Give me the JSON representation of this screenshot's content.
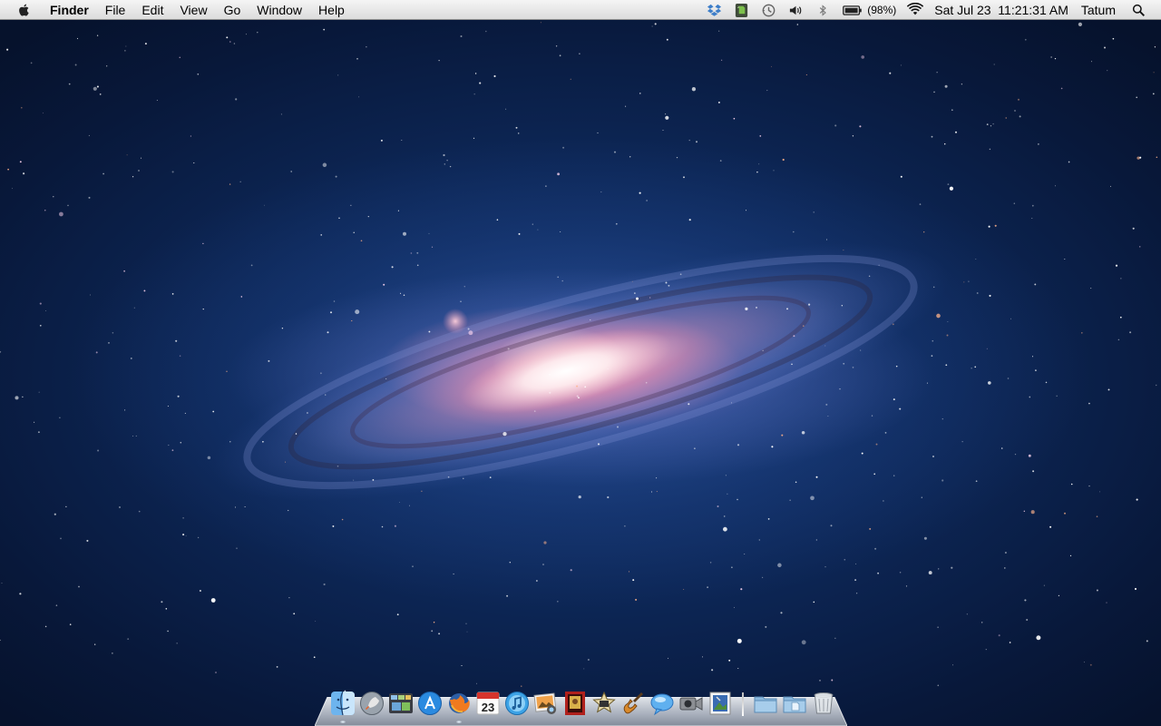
{
  "menubar": {
    "app_name": "Finder",
    "menus": [
      "File",
      "Edit",
      "View",
      "Go",
      "Window",
      "Help"
    ],
    "status_icons": [
      "dropbox-icon",
      "evernote-icon",
      "time-machine-icon",
      "volume-icon",
      "bluetooth-icon",
      "battery-icon",
      "wifi-icon",
      "spotlight-icon"
    ],
    "battery_percent": "(98%)",
    "datetime": "Sat Jul 23  11:21:31 AM",
    "user": "Tatum"
  },
  "desktop": {
    "wallpaper": "andromeda-galaxy"
  },
  "dock": {
    "items": [
      {
        "name": "finder-icon",
        "running": true
      },
      {
        "name": "launchpad-icon",
        "running": false
      },
      {
        "name": "mission-control-icon",
        "running": false
      },
      {
        "name": "app-store-icon",
        "running": false
      },
      {
        "name": "firefox-icon",
        "running": true
      },
      {
        "name": "ical-icon",
        "running": false,
        "label": "23"
      },
      {
        "name": "itunes-icon",
        "running": false
      },
      {
        "name": "iphoto-icon",
        "running": false
      },
      {
        "name": "photo-booth-icon",
        "running": false
      },
      {
        "name": "imovie-icon",
        "running": false
      },
      {
        "name": "garageband-icon",
        "running": false
      },
      {
        "name": "ichat-icon",
        "running": false
      },
      {
        "name": "facetime-icon",
        "running": false
      },
      {
        "name": "preview-icon",
        "running": false
      },
      {
        "name": "applications-folder-icon",
        "running": false
      },
      {
        "name": "documents-stack-icon",
        "running": false
      },
      {
        "name": "trash-icon",
        "running": false
      }
    ]
  },
  "colors": {
    "menubar": "#e8e8e8",
    "sky_deep": "#06122c",
    "sky_mid": "#173a78",
    "galaxy_core": "#fff5ec"
  }
}
